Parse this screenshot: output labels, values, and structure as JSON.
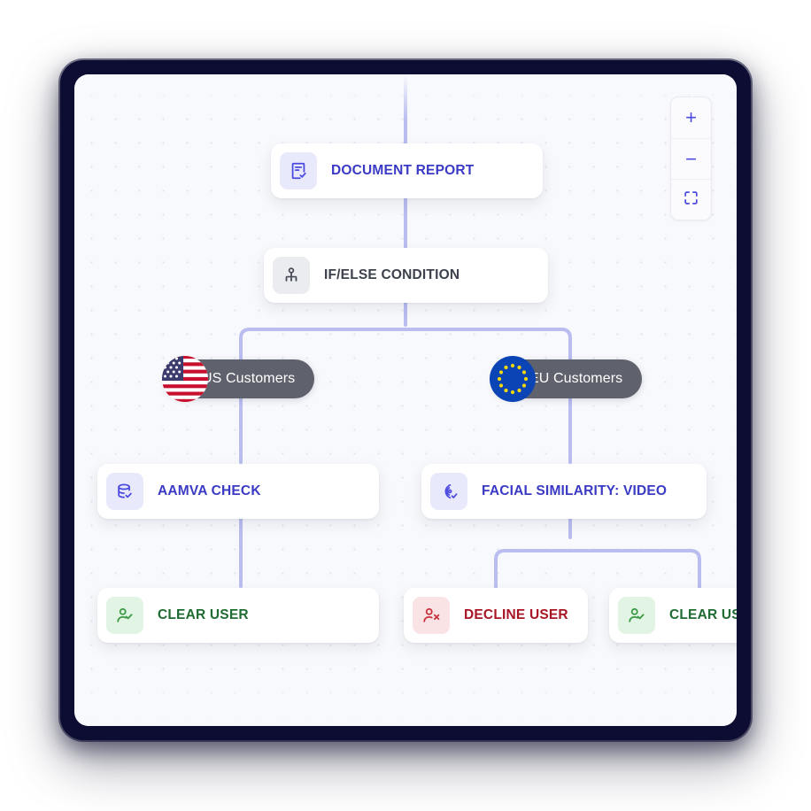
{
  "workflow": {
    "nodes": [
      {
        "id": "document-report",
        "label": "DOCUMENT REPORT",
        "icon": "document-check-icon",
        "theme": "indigo"
      },
      {
        "id": "if-else-condition",
        "label": "IF/ELSE CONDITION",
        "icon": "branch-hierarchy-icon",
        "theme": "grey"
      },
      {
        "id": "aamva-check",
        "label": "AAMVA CHECK",
        "icon": "database-check-icon",
        "theme": "indigo"
      },
      {
        "id": "facial-similarity-video",
        "label": "FACIAL SIMILARITY: VIDEO",
        "icon": "face-scan-icon",
        "theme": "indigo"
      },
      {
        "id": "clear-user-left",
        "label": "CLEAR USER",
        "icon": "user-check-icon",
        "theme": "green"
      },
      {
        "id": "decline-user",
        "label": "DECLINE USER",
        "icon": "user-x-icon",
        "theme": "red"
      },
      {
        "id": "clear-user-right",
        "label": "CLEAR USER",
        "icon": "user-check-icon",
        "theme": "green"
      }
    ],
    "branches": [
      {
        "id": "us-customers",
        "label": "US Customers",
        "flag": "us-flag-icon"
      },
      {
        "id": "eu-customers",
        "label": "EU Customers",
        "flag": "eu-flag-icon"
      }
    ]
  },
  "zoom_controls": {
    "zoom_in_label": "+",
    "zoom_out_label": "−",
    "fit_view_label": "fit-view-icon"
  },
  "colors": {
    "edge": "#b9bdf0",
    "frame": "#0d0d33",
    "canvas": "#f8f9fc",
    "indigo_text": "#3a3ac4",
    "grey_text": "#3c414c",
    "green_text": "#1f6b32",
    "red_text": "#a81524",
    "pill_background": "#5f626d",
    "accent": "#4a4ae0"
  }
}
